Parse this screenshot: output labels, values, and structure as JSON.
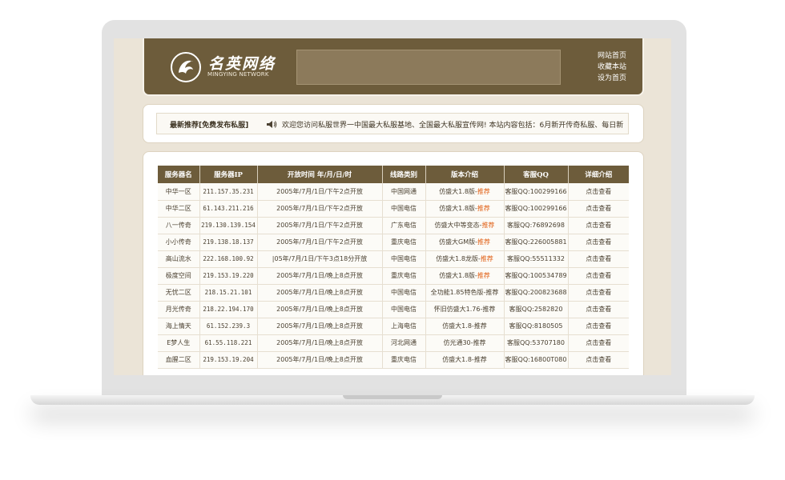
{
  "header": {
    "brand_cn": "名英网络",
    "brand_en": "MINGYING NETWORK",
    "links": [
      "网站首页",
      "收藏本站",
      "设为首页"
    ]
  },
  "notice": {
    "title": "最新推荐[免费发布私服]",
    "text": "欢迎您访问私服世界一中国最大私服基地、全国最大私服宣传网! 本站内容包括：6月新开传奇私服、每日新"
  },
  "table": {
    "headers": [
      "服务器名",
      "服务器IP",
      "开放时间 年/月/日/时",
      "线路类别",
      "版本介绍",
      "客服QQ",
      "详细介绍"
    ],
    "rows": [
      {
        "name": "中华一区",
        "ip": "211.157.35.231",
        "time": "2005年/7月/1日/下午2点开放",
        "line": "中国网通",
        "version": "仿盛大1.8版-",
        "tag": "推荐",
        "qq": "客服QQ:100299166",
        "detail": "点击查看"
      },
      {
        "name": "中华二区",
        "ip": "61.143.211.216",
        "time": "2005年/7月/1日/下午2点开放",
        "line": "中国电信",
        "version": "仿盛大1.8版-",
        "tag": "推荐",
        "qq": "客服QQ:100299166",
        "detail": "点击查看"
      },
      {
        "name": "八一传奇",
        "ip": "219.130.139.154",
        "time": "2005年/7月/1日/下午2点开放",
        "line": "广东电信",
        "version": "仿盛大中等变态-",
        "tag": "推荐",
        "qq": "客服QQ:76892698",
        "detail": "点击查看"
      },
      {
        "name": "小小传奇",
        "ip": "219.138.18.137",
        "time": "2005年/7月/1日/下午2点开放",
        "line": "重庆电信",
        "version": "仿盛大GM版-",
        "tag": "推荐",
        "qq": "客服QQ:226005881",
        "detail": "点击查看"
      },
      {
        "name": "高山流水",
        "ip": "222.168.100.92",
        "time": "|05年/7月/1日/下午3点18分开放",
        "line": "中国电信",
        "version": "仿盛大1.8龙版-",
        "tag": "推荐",
        "qq": "客服QQ:55511332",
        "detail": "点击查看"
      },
      {
        "name": "极度空间",
        "ip": "219.153.19.220",
        "time": "2005年/7月/1日/晚上8点开放",
        "line": "重庆电信",
        "version": "仿盛大1.8版-",
        "tag": "推荐",
        "qq": "客服QQ:100534789",
        "detail": "点击查看"
      },
      {
        "name": "无忧二区",
        "ip": "218.15.21.101",
        "time": "2005年/7月/1日/晚上8点开放",
        "line": "中国电信",
        "version": "全功能1.85特色版-推荐",
        "tag": "",
        "qq": "客服QQ:200823688",
        "detail": "点击查看"
      },
      {
        "name": "月光传奇",
        "ip": "218.22.194.170",
        "time": "2005年/7月/1日/晚上8点开放",
        "line": "中国电信",
        "version": "怀旧仿盛大1.76-推荐",
        "tag": "",
        "qq": "客服QQ:2582820",
        "detail": "点击查看"
      },
      {
        "name": "海上情天",
        "ip": "61.152.239.3",
        "time": "2005年/7月/1日/晚上8点开放",
        "line": "上海电信",
        "version": "仿盛大1.8-推荐",
        "tag": "",
        "qq": "客服QQ:8180505",
        "detail": "点击查看"
      },
      {
        "name": "E梦人生",
        "ip": "61.55.118.221",
        "time": "2005年/7月/1日/晚上8点开放",
        "line": "河北网通",
        "version": "仿光通30-推荐",
        "tag": "",
        "qq": "客服QQ:53707180",
        "detail": "点击查看"
      },
      {
        "name": "血腥二区",
        "ip": "219.153.19.204",
        "time": "2005年/7月/1日/晚上8点开放",
        "line": "重庆电信",
        "version": "仿盛大1.8-推荐",
        "tag": "",
        "qq": "客服QQ:16800T080",
        "detail": "点击查看"
      }
    ]
  },
  "colors": {
    "header_bg": "#6d5c3b",
    "page_bg": "#ebe4d7",
    "recommend": "#e05f14"
  }
}
